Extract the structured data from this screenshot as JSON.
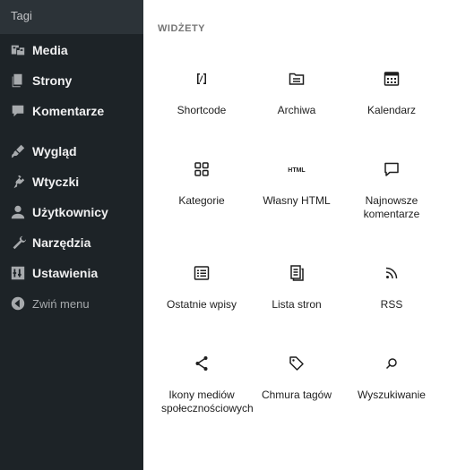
{
  "sidebar": {
    "submenu_item": "Tagi",
    "items": [
      {
        "label": "Media",
        "icon": "media-icon"
      },
      {
        "label": "Strony",
        "icon": "pages-icon"
      },
      {
        "label": "Komentarze",
        "icon": "comments-icon"
      },
      {
        "label": "Wygląd",
        "icon": "appearance-icon"
      },
      {
        "label": "Wtyczki",
        "icon": "plugins-icon"
      },
      {
        "label": "Użytkownicy",
        "icon": "users-icon"
      },
      {
        "label": "Narzędzia",
        "icon": "tools-icon"
      },
      {
        "label": "Ustawienia",
        "icon": "settings-icon"
      }
    ],
    "collapse_label": "Zwiń menu"
  },
  "inserter": {
    "title": "WIDŻETY",
    "blocks": [
      {
        "label": "Shortcode",
        "icon": "shortcode-icon"
      },
      {
        "label": "Archiwa",
        "icon": "archive-icon"
      },
      {
        "label": "Kalendarz",
        "icon": "calendar-icon"
      },
      {
        "label": "Kategorie",
        "icon": "categories-icon"
      },
      {
        "label": "Własny HTML",
        "icon": "html-icon",
        "glyph": "HTML"
      },
      {
        "label": "Najnowsze komentarze",
        "icon": "latest-comments-icon"
      },
      {
        "label": "Ostatnie wpisy",
        "icon": "latest-posts-icon"
      },
      {
        "label": "Lista stron",
        "icon": "page-list-icon"
      },
      {
        "label": "RSS",
        "icon": "rss-icon"
      },
      {
        "label": "Ikony mediów społecznościowych",
        "icon": "social-icons-icon"
      },
      {
        "label": "Chmura tagów",
        "icon": "tag-cloud-icon"
      },
      {
        "label": "Wyszukiwanie",
        "icon": "search-icon"
      }
    ]
  },
  "colors": {
    "sidebar_bg": "#1d2327",
    "submenu_bg": "#2c3338",
    "panel_bg": "#ffffff",
    "icon_dark": "#1e1e1e"
  }
}
